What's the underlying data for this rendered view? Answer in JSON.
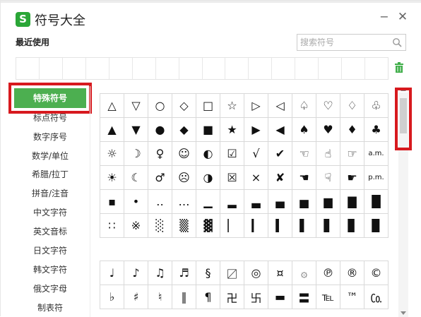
{
  "window": {
    "title": "符号大全",
    "logo": "S",
    "minimize": "−",
    "close": "✕"
  },
  "recent": {
    "label": "最近使用"
  },
  "search": {
    "placeholder": "搜索符号"
  },
  "categories": [
    "特殊符号",
    "标点符号",
    "数字序号",
    "数学/单位",
    "希腊/拉丁",
    "拼音/注音",
    "中文字符",
    "英文音标",
    "日文字符",
    "韩文字符",
    "俄文字母",
    "制表符"
  ],
  "active_category": "特殊符号",
  "symbols_group1": [
    [
      "△",
      "▽",
      "○",
      "◇",
      "□",
      "☆",
      "▷",
      "◁",
      "♤",
      "♡",
      "♢",
      "♧"
    ],
    [
      "▲",
      "▼",
      "●",
      "◆",
      "■",
      "★",
      "▶",
      "◀",
      "♠",
      "♥",
      "♦",
      "♣"
    ],
    [
      "☼",
      "☽",
      "♀",
      "☺",
      "◐",
      "☑",
      "√",
      "✔",
      "☜",
      "☝",
      "☞",
      "a.m."
    ],
    [
      "☀",
      "☾",
      "♂",
      "☹",
      "◑",
      "☒",
      "×",
      "✘",
      "☚",
      "☟",
      "☛",
      "p.m."
    ],
    [
      "▪",
      "•",
      "‥",
      "…",
      "▁",
      "▂",
      "▃",
      "▄",
      "▅",
      "▆",
      "▇",
      "█"
    ],
    [
      "∷",
      "※",
      "░",
      "▒",
      "▓",
      "▏",
      "▎",
      "▍",
      "▌",
      "▋",
      "▊",
      "▉"
    ]
  ],
  "symbols_group2": [
    [
      "♩",
      "♪",
      "♫",
      "♬",
      "§",
      "〼",
      "◎",
      "¤",
      "۞",
      "℗",
      "®",
      "©"
    ],
    [
      "♭",
      "♯",
      "♮",
      "‖",
      "¶",
      "卍",
      "卐",
      "▬",
      "〓",
      "℡",
      "™",
      "㏇"
    ]
  ],
  "colors": {
    "accent": "#4caf50",
    "highlight": "#d7191e",
    "logo": "#2aa637"
  }
}
